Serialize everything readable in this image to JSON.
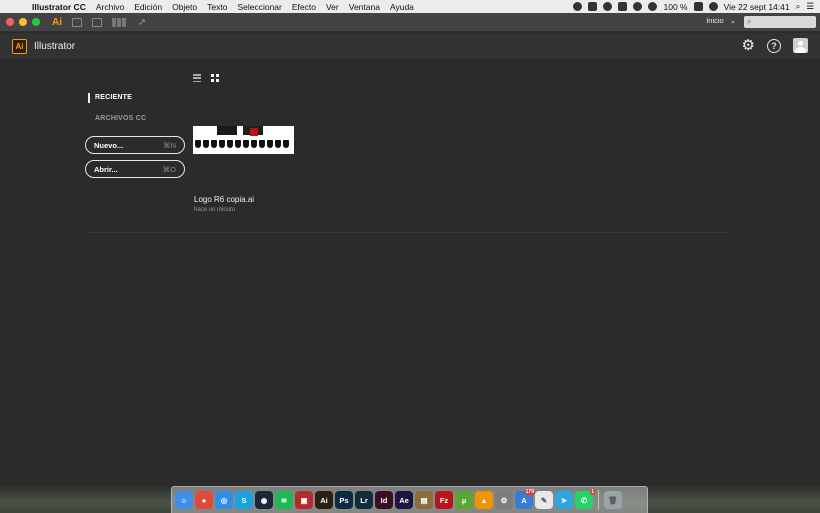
{
  "menubar": {
    "app_name": "Illustrator CC",
    "items": [
      "Archivo",
      "Edición",
      "Objeto",
      "Texto",
      "Seleccionar",
      "Efecto",
      "Ver",
      "Ventana",
      "Ayuda"
    ],
    "battery": "100 %",
    "datetime": "Vie 22 sept  14:41"
  },
  "titlebar": {
    "app_badge": "Ai",
    "workspace_label": "Inicio",
    "workspace_arrow": "⌄"
  },
  "header": {
    "logo": "Ai",
    "app_name": "Illustrator"
  },
  "nav": {
    "recent": "RECIENTE",
    "cc_files": "ARCHIVOS CC"
  },
  "actions": {
    "new_label": "Nuevo...",
    "new_shortcut": "⌘N",
    "open_label": "Abrir...",
    "open_shortcut": "⌘O"
  },
  "recent_file": {
    "name": "Logo R6 copia.ai",
    "time": "hace un minuto"
  },
  "dock": [
    {
      "name": "finder",
      "glyph": "☺",
      "color": "#3f8ee8"
    },
    {
      "name": "chrome",
      "glyph": "●",
      "color": "#e04a3a"
    },
    {
      "name": "safari",
      "glyph": "◎",
      "color": "#2d8fe6"
    },
    {
      "name": "skype",
      "glyph": "S",
      "color": "#1aa3e3"
    },
    {
      "name": "steam",
      "glyph": "◉",
      "color": "#1b2838"
    },
    {
      "name": "spotify",
      "glyph": "≋",
      "color": "#1db954"
    },
    {
      "name": "photobooth",
      "glyph": "▣",
      "color": "#b52a2a"
    },
    {
      "name": "illustrator",
      "glyph": "Ai",
      "color": "#2b1e12"
    },
    {
      "name": "photoshop",
      "glyph": "Ps",
      "color": "#0b2b44"
    },
    {
      "name": "lightroom",
      "glyph": "Lr",
      "color": "#132b3a"
    },
    {
      "name": "indesign",
      "glyph": "Id",
      "color": "#3a0f26"
    },
    {
      "name": "aftereffects",
      "glyph": "Ae",
      "color": "#1e1540"
    },
    {
      "name": "preview",
      "glyph": "▤",
      "color": "#8a6d3b"
    },
    {
      "name": "filezilla",
      "glyph": "Fz",
      "color": "#b8141b"
    },
    {
      "name": "utorrent",
      "glyph": "µ",
      "color": "#5aa632"
    },
    {
      "name": "vlc",
      "glyph": "▲",
      "color": "#f29400"
    },
    {
      "name": "system-preferences",
      "glyph": "⚙",
      "color": "#7d7d7d"
    },
    {
      "name": "app-store",
      "glyph": "A",
      "color": "#3a7bd5",
      "badge": "179"
    },
    {
      "name": "textedit",
      "glyph": "✎",
      "color": "#e8e8e8"
    },
    {
      "name": "telegram",
      "glyph": "➤",
      "color": "#2ca5e0"
    },
    {
      "name": "whatsapp",
      "glyph": "✆",
      "color": "#25d366",
      "badge": "1"
    },
    {
      "name": "trash",
      "glyph": "🗑",
      "color": "#9aa3a8"
    }
  ]
}
